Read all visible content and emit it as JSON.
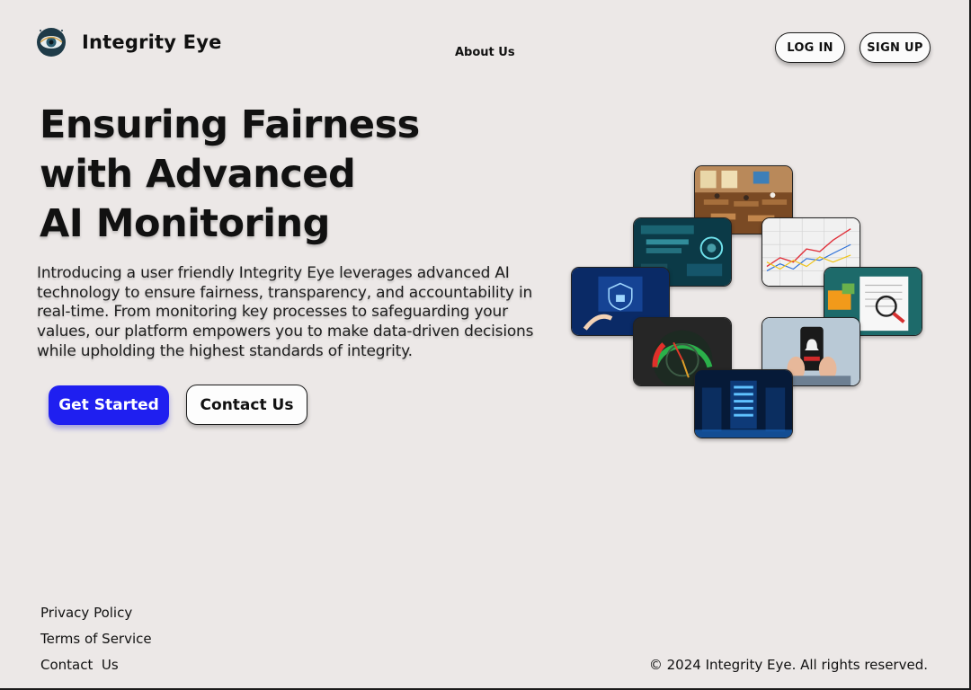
{
  "brand": {
    "name": "Integrity Eye",
    "logo_icon": "eye-logo-icon"
  },
  "nav": {
    "about": "About Us",
    "login": "LOG IN",
    "signup": "SIGN UP"
  },
  "hero": {
    "title_line1": "Ensuring Fairness",
    "title_line2": "with Advanced",
    "title_line3": "AI Monitoring",
    "description": "Introducing a user friendly Integrity Eye leverages advanced AI technology to ensure fairness, transparency, and accountability in real-time. From monitoring key processes to safeguarding your values, our platform empowers you to make data-driven decisions while upholding the highest standards of integrity.",
    "primary_cta": "Get Started",
    "secondary_cta": "Contact Us"
  },
  "collage": [
    {
      "name": "classroom-image"
    },
    {
      "name": "dashboard-image"
    },
    {
      "name": "line-chart-image"
    },
    {
      "name": "security-tech-image"
    },
    {
      "name": "document-review-image"
    },
    {
      "name": "gauge-image"
    },
    {
      "name": "phone-alert-image"
    },
    {
      "name": "server-room-image"
    }
  ],
  "footer": {
    "privacy": "Privacy Policy",
    "terms": "Terms of Service",
    "contact": "Contact  Us",
    "copyright": "© 2024 Integrity Eye. All rights reserved."
  },
  "colors": {
    "background": "#ece8e7",
    "primary": "#1f1ff0",
    "text": "#111111"
  }
}
